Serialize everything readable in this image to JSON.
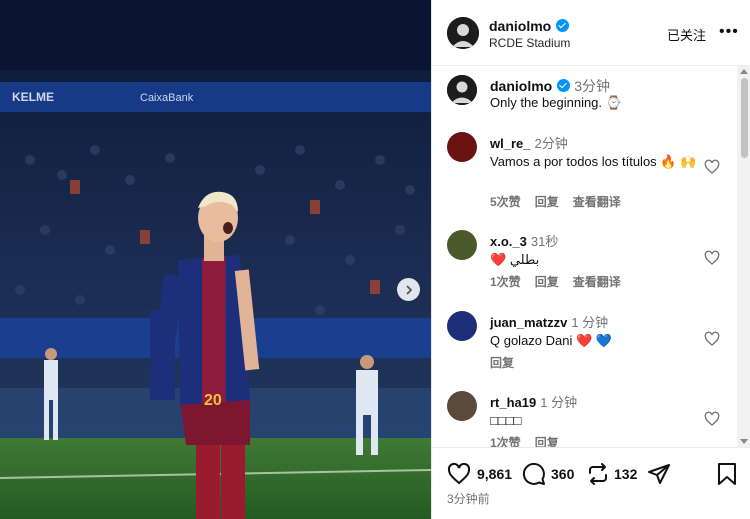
{
  "post": {
    "username": "daniolmo",
    "location": "RCDE Stadium",
    "follow_label": "已关注",
    "more_label": "•••",
    "caption_time": "3分钟",
    "caption_text": "Only the beginning. ⌚"
  },
  "comments": [
    {
      "user": "wl_re_",
      "time": "2分钟",
      "text": "Vamos a por todos los títulos 🔥 🙌",
      "likes": "5次赞",
      "reply": "回复",
      "translate": "查看翻译"
    },
    {
      "user": "x.o._3",
      "time": "31秒",
      "text": "❤️ بطلي",
      "likes": "1次赞",
      "reply": "回复",
      "translate": "查看翻译"
    },
    {
      "user": "juan_matzzv",
      "time": "1 分钟",
      "text": "Q golazo Dani ❤️ 💙",
      "likes": "",
      "reply": "回复",
      "translate": ""
    },
    {
      "user": "rt_ha19",
      "time": "1 分钟",
      "text": "□□□□",
      "likes": "1次赞",
      "reply": "回复",
      "translate": ""
    }
  ],
  "stats": {
    "likes": "9,861",
    "comments": "360",
    "reposts": "132",
    "time_ago": "3分钟前"
  },
  "colors": {
    "verified": "#0095f6",
    "barca_blue": "#1d2f7a",
    "barca_red": "#9b1b2e",
    "pitch": "#2f6b2a"
  },
  "icons": [
    "verified-badge",
    "heart-icon",
    "comment-icon",
    "repost-icon",
    "share-icon",
    "bookmark-icon",
    "chevron-right-icon"
  ]
}
